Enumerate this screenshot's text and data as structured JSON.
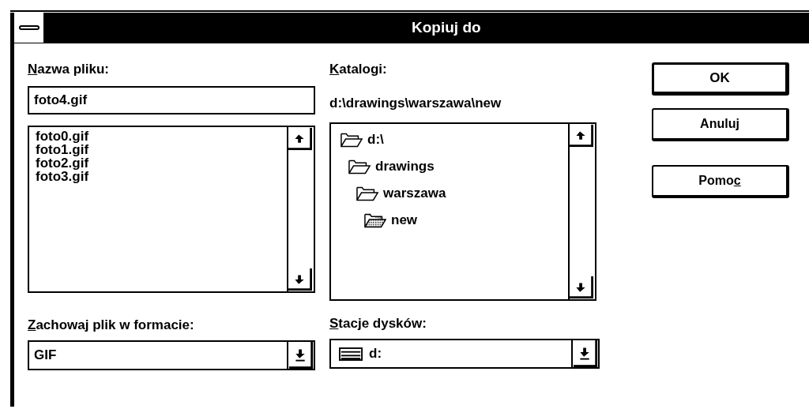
{
  "window": {
    "title": "Kopiuj do"
  },
  "file_name": {
    "label": [
      {
        "text": "N",
        "underlined": true
      },
      {
        "text": "azwa pliku:",
        "underlined": false
      }
    ],
    "value": "foto4.gif"
  },
  "files": [
    {
      "name": "foto0.gif"
    },
    {
      "name": "foto1.gif"
    },
    {
      "name": "foto2.gif"
    },
    {
      "name": "foto3.gif"
    }
  ],
  "directories": {
    "label": [
      {
        "text": "K",
        "underlined": true
      },
      {
        "text": "atalogi:",
        "underlined": false
      }
    ],
    "path": "d:\\drawings\\warszawa\\new",
    "tree": [
      {
        "name": "d:\\",
        "current": false,
        "children": [
          {
            "name": "drawings",
            "current": false,
            "children": [
              {
                "name": "warszawa",
                "current": false,
                "children": [
                  {
                    "name": "new",
                    "current": true
                  }
                ]
              }
            ]
          }
        ]
      }
    ]
  },
  "format": {
    "label": [
      {
        "text": "Z",
        "underlined": true
      },
      {
        "text": "achowaj plik w formacie:",
        "underlined": false
      }
    ],
    "value": "GIF"
  },
  "drives": {
    "label": [
      {
        "text": "S",
        "underlined": true
      },
      {
        "text": "tacje dysków:",
        "underlined": false
      }
    ],
    "value": "d:"
  },
  "buttons": [
    {
      "label": [
        {
          "text": "OK",
          "underlined": false
        }
      ],
      "default": true
    },
    {
      "label": [
        {
          "text": "Anuluj",
          "underlined": false
        }
      ],
      "default": false
    },
    {
      "label": [
        {
          "text": "Pomo",
          "underlined": false
        },
        {
          "text": "c",
          "underlined": true
        }
      ],
      "default": false
    }
  ]
}
